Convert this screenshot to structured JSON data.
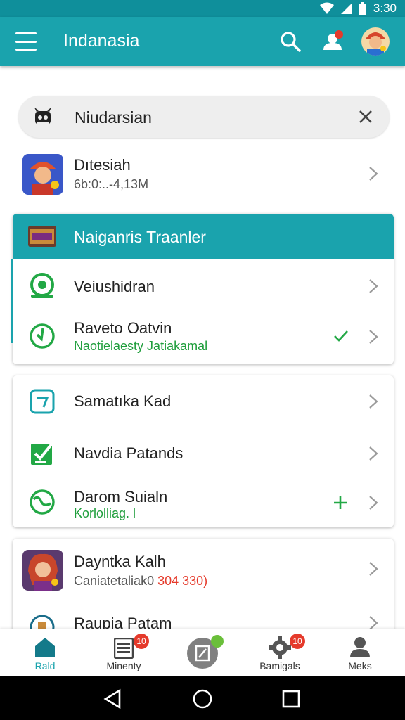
{
  "status_bar": {
    "time": "3:30"
  },
  "app_bar": {
    "title": "Indanasia"
  },
  "search": {
    "value": "Niudarsian"
  },
  "top_item": {
    "title": "Dıtesiah",
    "subtitle": "6b:0:..-4,13M"
  },
  "group_one": {
    "header": "Naiganris Traanler",
    "items": [
      {
        "title": "Veiushidran"
      },
      {
        "title": "Raveto Oatvin",
        "subtitle": "Naotielaesty Jatiakamal"
      }
    ]
  },
  "group_two": {
    "items": [
      {
        "title": "Samatıka Kad"
      },
      {
        "title": "Navdia Patands"
      },
      {
        "title": "Darom Suialn",
        "subtitle": "Korlolliag. l"
      }
    ]
  },
  "group_three": {
    "items": [
      {
        "title": "Dayntka Kalh",
        "subtitle_prefix": "Caniatetaliak0",
        "subtitle_highlight": " 304 330)"
      },
      {
        "title": "Raupia Patam"
      }
    ]
  },
  "bottom_nav": {
    "items": [
      {
        "label": "Rald"
      },
      {
        "label": "Minenty",
        "badge": "10"
      },
      {
        "label": "",
        "badge": ""
      },
      {
        "label": "Bamigals",
        "badge": "10"
      },
      {
        "label": "Meks"
      }
    ]
  },
  "colors": {
    "teal": "#1aa3ad",
    "green": "#22a845",
    "accent_red": "#e53a2b"
  }
}
